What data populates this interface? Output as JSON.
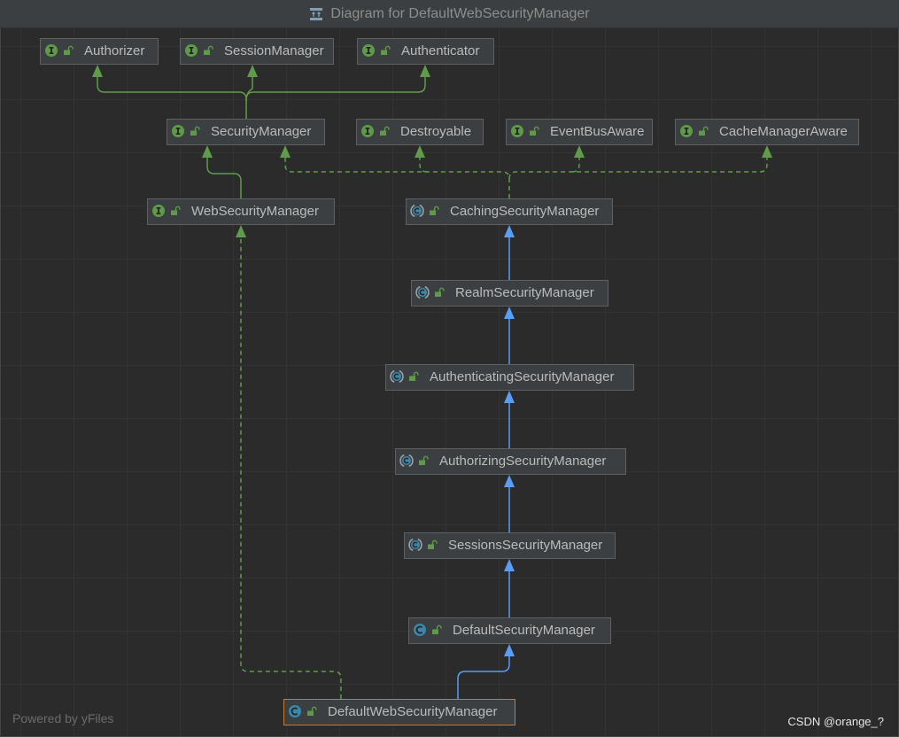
{
  "window": {
    "title": "Diagram for DefaultWebSecurityManager",
    "icon": "diagram-icon"
  },
  "nodes": [
    {
      "label": "Authorizer",
      "icon": "interface-icon"
    },
    {
      "label": "SessionManager",
      "icon": "interface-icon"
    },
    {
      "label": "Authenticator",
      "icon": "interface-icon"
    },
    {
      "label": "SecurityManager",
      "icon": "interface-icon"
    },
    {
      "label": "Destroyable",
      "icon": "interface-icon"
    },
    {
      "label": "EventBusAware",
      "icon": "interface-icon"
    },
    {
      "label": "CacheManagerAware",
      "icon": "interface-icon"
    },
    {
      "label": "WebSecurityManager",
      "icon": "interface-icon"
    },
    {
      "label": "CachingSecurityManager",
      "icon": "abstract-class-icon"
    },
    {
      "label": "RealmSecurityManager",
      "icon": "abstract-class-icon"
    },
    {
      "label": "AuthenticatingSecurityManager",
      "icon": "abstract-class-icon"
    },
    {
      "label": "AuthorizingSecurityManager",
      "icon": "abstract-class-icon"
    },
    {
      "label": "SessionsSecurityManager",
      "icon": "abstract-class-icon"
    },
    {
      "label": "DefaultSecurityManager",
      "icon": "class-icon"
    },
    {
      "label": "DefaultWebSecurityManager",
      "icon": "class-icon",
      "selected": true
    }
  ],
  "node_visibility_icon": "lock-open-icon",
  "edges": {
    "interface_extends": [
      [
        3,
        0
      ],
      [
        3,
        1
      ],
      [
        3,
        2
      ],
      [
        7,
        3
      ]
    ],
    "implements": [
      [
        8,
        3
      ],
      [
        8,
        4
      ],
      [
        8,
        5
      ],
      [
        8,
        6
      ],
      [
        14,
        7
      ]
    ],
    "class_extends": [
      [
        9,
        8
      ],
      [
        10,
        9
      ],
      [
        11,
        10
      ],
      [
        12,
        11
      ],
      [
        13,
        12
      ],
      [
        14,
        13
      ]
    ]
  },
  "footer": {
    "powered_by": "Powered by yFiles",
    "watermark": "CSDN @orange_?"
  },
  "colors": {
    "canvas": "#2b2b2b",
    "node_fill": "#3c3f41",
    "node_border": "#5e6062",
    "node_text": "#bbbbbb",
    "selection": "#c57a35",
    "interface_edge": "#5f9b4b",
    "class_edge": "#589df6"
  }
}
